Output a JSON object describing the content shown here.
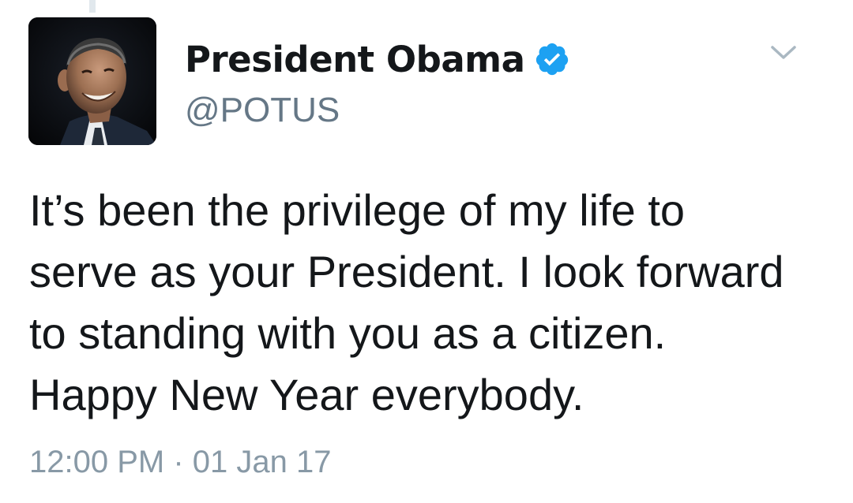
{
  "tweet": {
    "display_name": "President Obama",
    "handle": "@POTUS",
    "verified": true,
    "text_lines": [
      "It’s been the privilege of my life to",
      "serve as your President. I look forward",
      "to standing with you as a citizen.",
      "Happy New Year everybody."
    ],
    "time": "12:00 PM",
    "separator": "·",
    "date": "01 Jan 17"
  },
  "icons": {
    "verified": "verified-badge-icon",
    "menu": "chevron-down-icon"
  },
  "colors": {
    "verified_blue": "#1da1f2",
    "name_text": "#14171a",
    "handle_text": "#657786",
    "timestamp_text": "#8899a6",
    "chevron": "#aab8c2"
  }
}
